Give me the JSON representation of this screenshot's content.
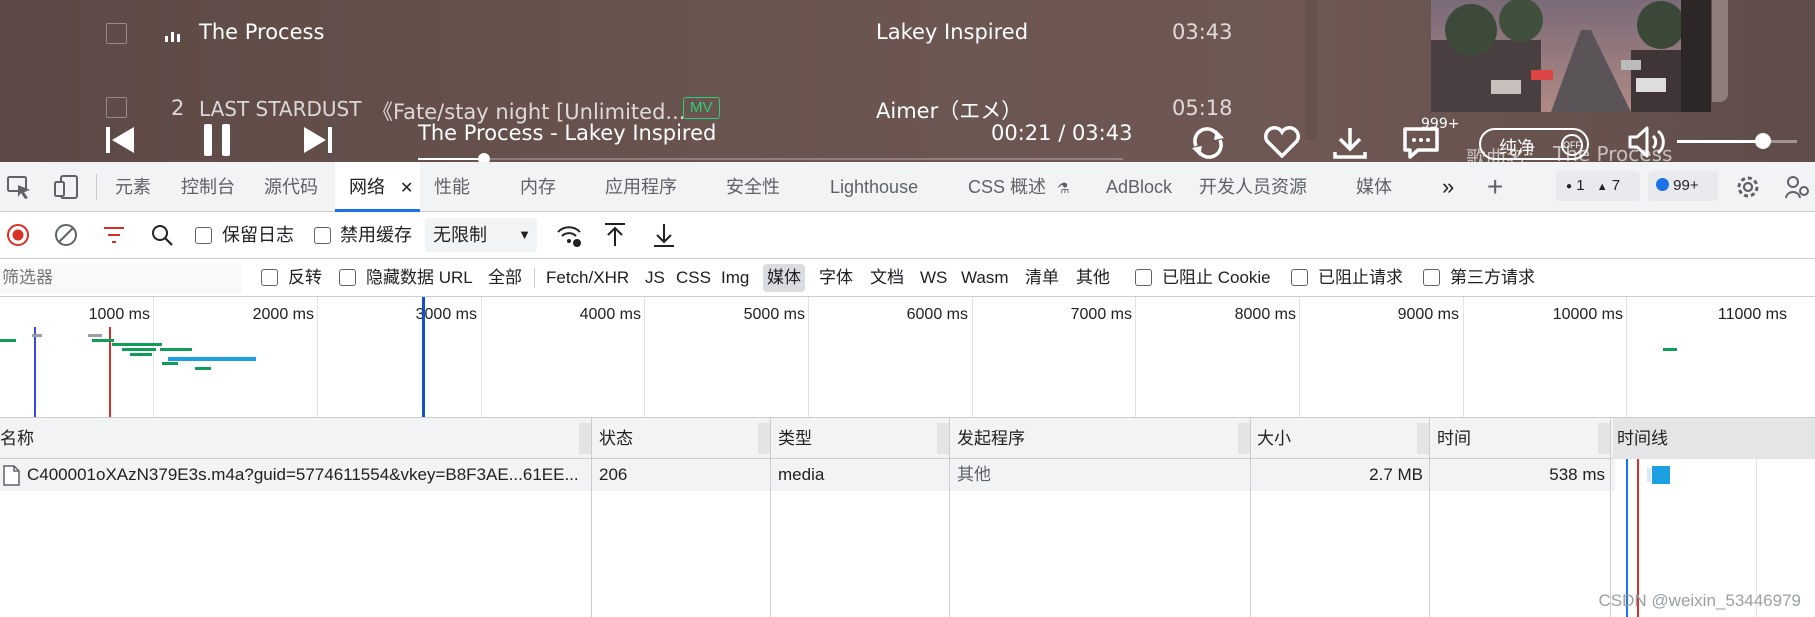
{
  "player": {
    "songs": [
      {
        "index": "",
        "title": "The Process",
        "subtitle": "",
        "artist": "Lakey Inspired",
        "duration": "03:43"
      },
      {
        "index": "2",
        "title": "LAST STARDUST",
        "subtitle": "《Fate/stay night [Unlimited...",
        "badge": "MV",
        "artist": "Aimer（エメ）",
        "duration": "05:18"
      }
    ],
    "now_playing": "The Process - Lakey Inspired",
    "time": "00:21 / 03:43",
    "comment_count": "999+",
    "toggle_label": "纯净",
    "toggle_state": "OFF",
    "lyric_label": "歌曲名：",
    "lyric_song": "The Process",
    "volume": 0.72,
    "progress": 0.094
  },
  "devtools": {
    "tabs": [
      "元素",
      "控制台",
      "源代码",
      "网络",
      "性能",
      "内存",
      "应用程序",
      "安全性",
      "Lighthouse",
      "CSS 概述",
      "AdBlock",
      "开发人员资源",
      "媒体"
    ],
    "active_tab": "网络",
    "errors": "1",
    "warnings": "7",
    "messages": "99+"
  },
  "toolbar": {
    "preserve_log": "保留日志",
    "disable_cache": "禁用缓存",
    "throttle": "无限制"
  },
  "filter": {
    "placeholder": "筛选器",
    "invert": "反转",
    "hide_data_urls": "隐藏数据 URL",
    "types": [
      "全部",
      "Fetch/XHR",
      "JS",
      "CSS",
      "Img",
      "媒体",
      "字体",
      "文档",
      "WS",
      "Wasm",
      "清单",
      "其他"
    ],
    "selected_type": "媒体",
    "blocked_cookies": "已阻止 Cookie",
    "blocked_requests": "已阻止请求",
    "third_party": "第三方请求"
  },
  "overview": {
    "ticks": [
      "1000 ms",
      "2000 ms",
      "3000 ms",
      "4000 ms",
      "5000 ms",
      "6000 ms",
      "7000 ms",
      "8000 ms",
      "9000 ms",
      "10000 ms",
      "11000 ms"
    ]
  },
  "table": {
    "headers": [
      "名称",
      "状态",
      "类型",
      "发起程序",
      "大小",
      "时间",
      "时间线"
    ],
    "rows": [
      {
        "name": "C400001oXAzN379E3s.m4a?guid=5774611554&vkey=B8F3AE...61EE...",
        "status": "206",
        "type": "media",
        "initiator": "其他",
        "size": "2.7 MB",
        "time": "538 ms"
      }
    ]
  },
  "watermark": "CSDN @weixin_53446979",
  "colors": {
    "accent": "#1a73e8",
    "record": "#d93025",
    "mv_green": "#2ccf73",
    "bar_blue": "#1ba1e2",
    "bar_green": "#0f9d58"
  }
}
